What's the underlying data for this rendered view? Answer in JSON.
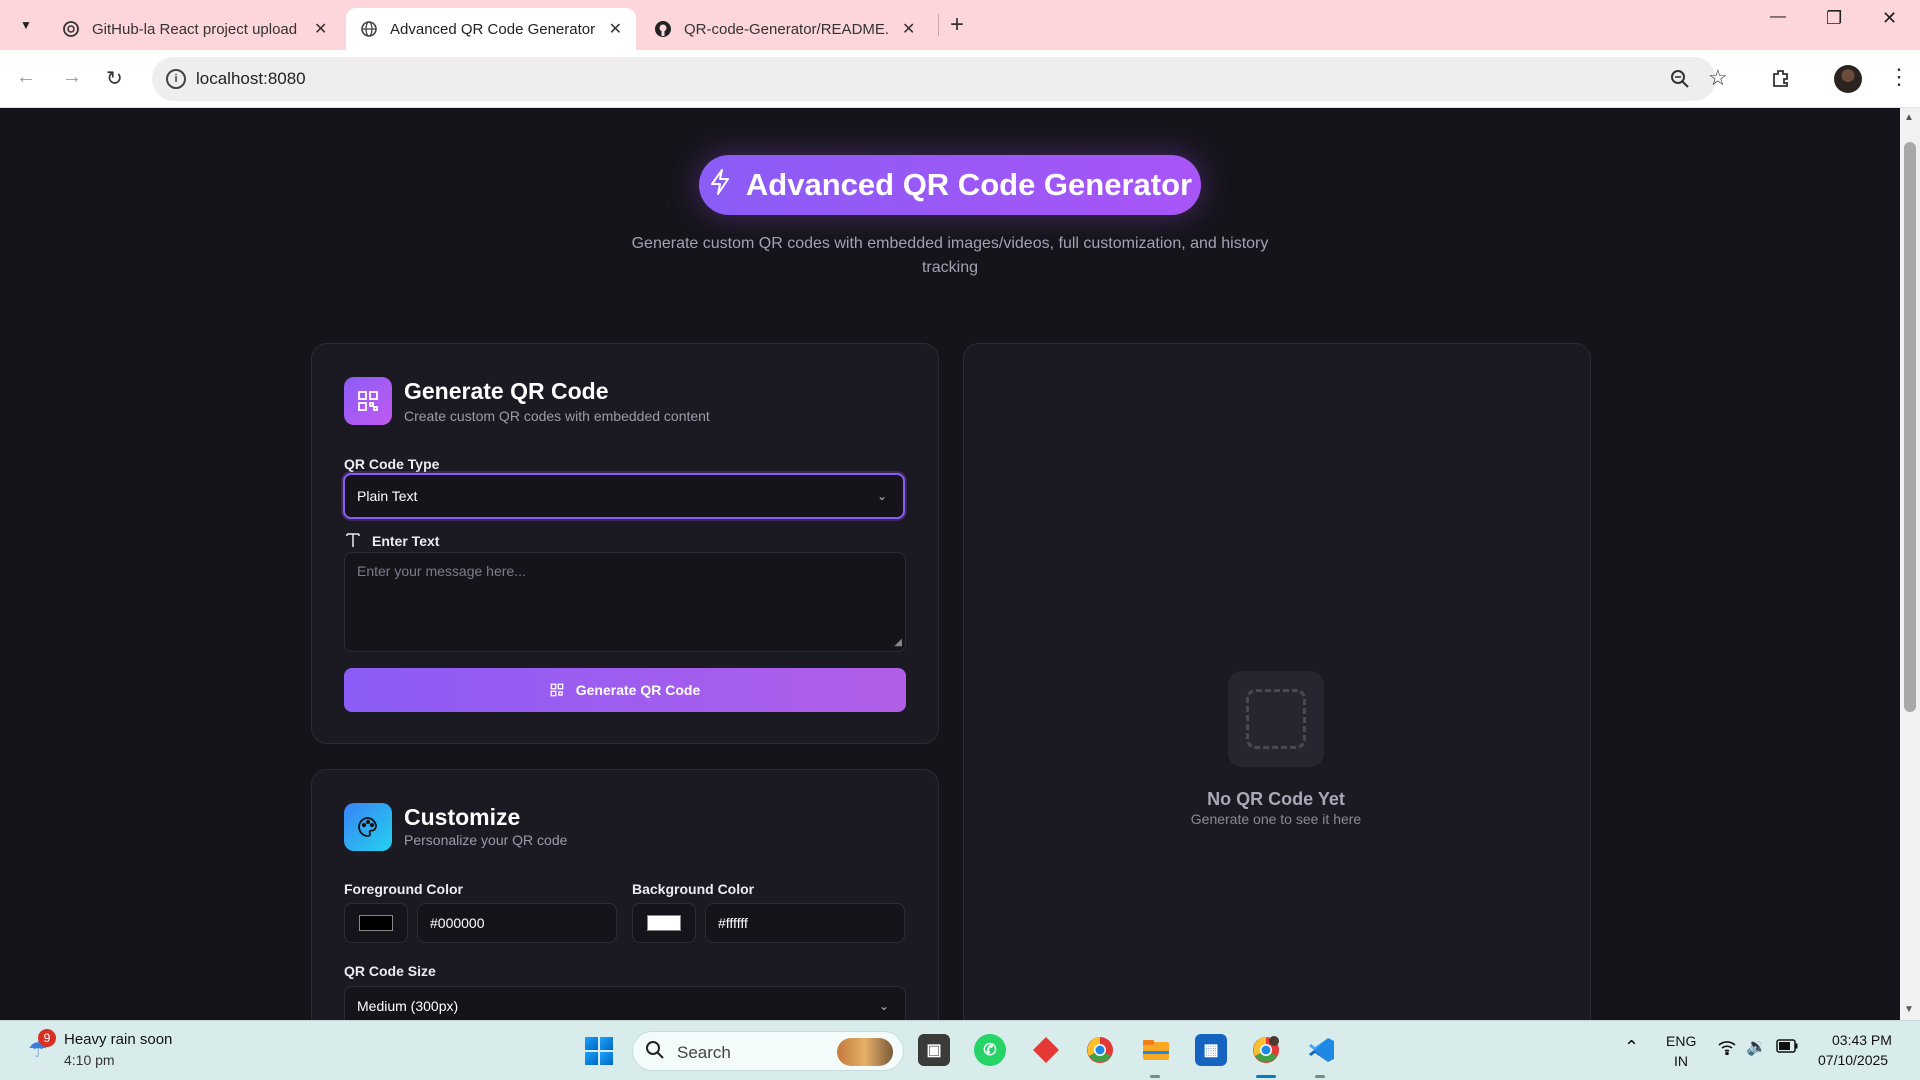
{
  "browser": {
    "tabs": [
      {
        "title": "GitHub-la React project upload",
        "active": false
      },
      {
        "title": "Advanced QR Code Generator -",
        "active": true
      },
      {
        "title": "QR-code-Generator/README.n",
        "active": false
      }
    ],
    "url": "localhost:8080"
  },
  "page": {
    "hero_title": "Advanced QR Code Generator",
    "subtitle": "Generate custom QR codes with embedded images/videos, full customization, and history tracking",
    "generate_card": {
      "title": "Generate QR Code",
      "subtitle": "Create custom QR codes with embedded content",
      "type_label": "QR Code Type",
      "type_value": "Plain Text",
      "text_label": "Enter Text",
      "text_placeholder": "Enter your message here...",
      "button_label": "Generate QR Code"
    },
    "customize_card": {
      "title": "Customize",
      "subtitle": "Personalize your QR code",
      "fg_label": "Foreground Color",
      "fg_value": "#000000",
      "bg_label": "Background Color",
      "bg_value": "#ffffff",
      "size_label": "QR Code Size",
      "size_value": "Medium (300px)"
    },
    "preview": {
      "empty_title": "No QR Code Yet",
      "empty_subtitle": "Generate one to see it here"
    },
    "colors": {
      "accent": "#8b5cf6",
      "accent2": "#a855f7",
      "background": "#15141b",
      "card": "#1b1a22"
    }
  },
  "taskbar": {
    "weather_badge": "9",
    "weather_text": "Heavy rain soon",
    "weather_time": "4:10 pm",
    "search_placeholder": "Search",
    "lang_line1": "ENG",
    "lang_line2": "IN",
    "time": "03:43 PM",
    "date": "07/10/2025"
  }
}
